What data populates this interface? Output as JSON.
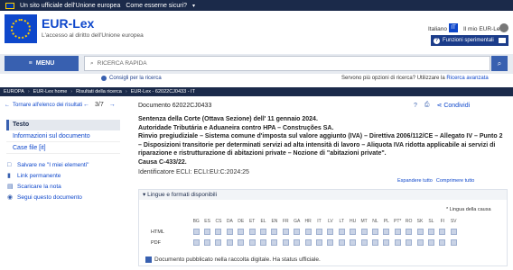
{
  "eu_banner": {
    "text": "Un sito ufficiale dell'Unione europea",
    "link": "Come esserne sicuri?"
  },
  "header": {
    "title": "EUR-Lex",
    "subtitle": "L'accesso al diritto dell'Unione europea",
    "language": "Italiano",
    "language_code": "IT",
    "my_eurlex": "Il mio EUR-Lex",
    "experimental": "Funzioni sperimentali"
  },
  "search": {
    "menu_label": "MENU",
    "placeholder": "RICERCA RAPIDA",
    "tips": "Consigli per la ricerca",
    "more_options": "Servono più opzioni di ricerca? Utilizzare la",
    "advanced_link": "Ricerca avanzata"
  },
  "breadcrumb": [
    "EUROPA",
    "EUR-Lex home",
    "Risultati della ricerca",
    "EUR-Lex - 62022CJ0433 - IT"
  ],
  "nav": {
    "back": "Tornare all'elenco dei risultati",
    "page": "3/7"
  },
  "sidebar": {
    "heading": "Testo",
    "items": [
      "Informazioni sul documento",
      "Case file [it]"
    ],
    "actions": [
      "Salvare ne \"I miei elementi\"",
      "Link permanente",
      "Scaricare la nota",
      "Segui questo documento"
    ]
  },
  "document": {
    "title": "Documento 62022CJ0433",
    "share": "Condividi",
    "line1": "Sentenza della Corte (Ottava Sezione) dell' 11 gennaio 2024.",
    "line2": "Autoridade Tributária e Aduaneira contro HPA – Construções SA.",
    "line3": "Rinvio pregiudiziale – Sistema comune d'imposta sul valore aggiunto (IVA) – Direttiva 2006/112/CE – Allegato IV – Punto 2 – Disposizioni transitorie per determinati servizi ad alta intensità di lavoro – Aliquota IVA ridotta applicabile ai servizi di riparazione e ristrutturazione di abitazioni private – Nozione di \"abitazioni private\".",
    "line4": "Causa C-433/22.",
    "ecli": "Identificatore ECLI: ECLI:EU:C:2024:25",
    "expand": "Espandere tutto",
    "collapse": "Comprimere tutto"
  },
  "languages": {
    "heading": "Lingue e formati disponibili",
    "legend": "Lingua della causa",
    "codes": [
      "BG",
      "ES",
      "CS",
      "DA",
      "DE",
      "ET",
      "EL",
      "EN",
      "FR",
      "GA",
      "HR",
      "IT",
      "LV",
      "LT",
      "HU",
      "MT",
      "NL",
      "PL",
      "PT*",
      "RO",
      "SK",
      "SL",
      "FI",
      "SV"
    ],
    "rows": [
      "HTML",
      "PDF"
    ],
    "note": "Documento pubblicato nella raccolta digitale. Ha status ufficiale."
  }
}
